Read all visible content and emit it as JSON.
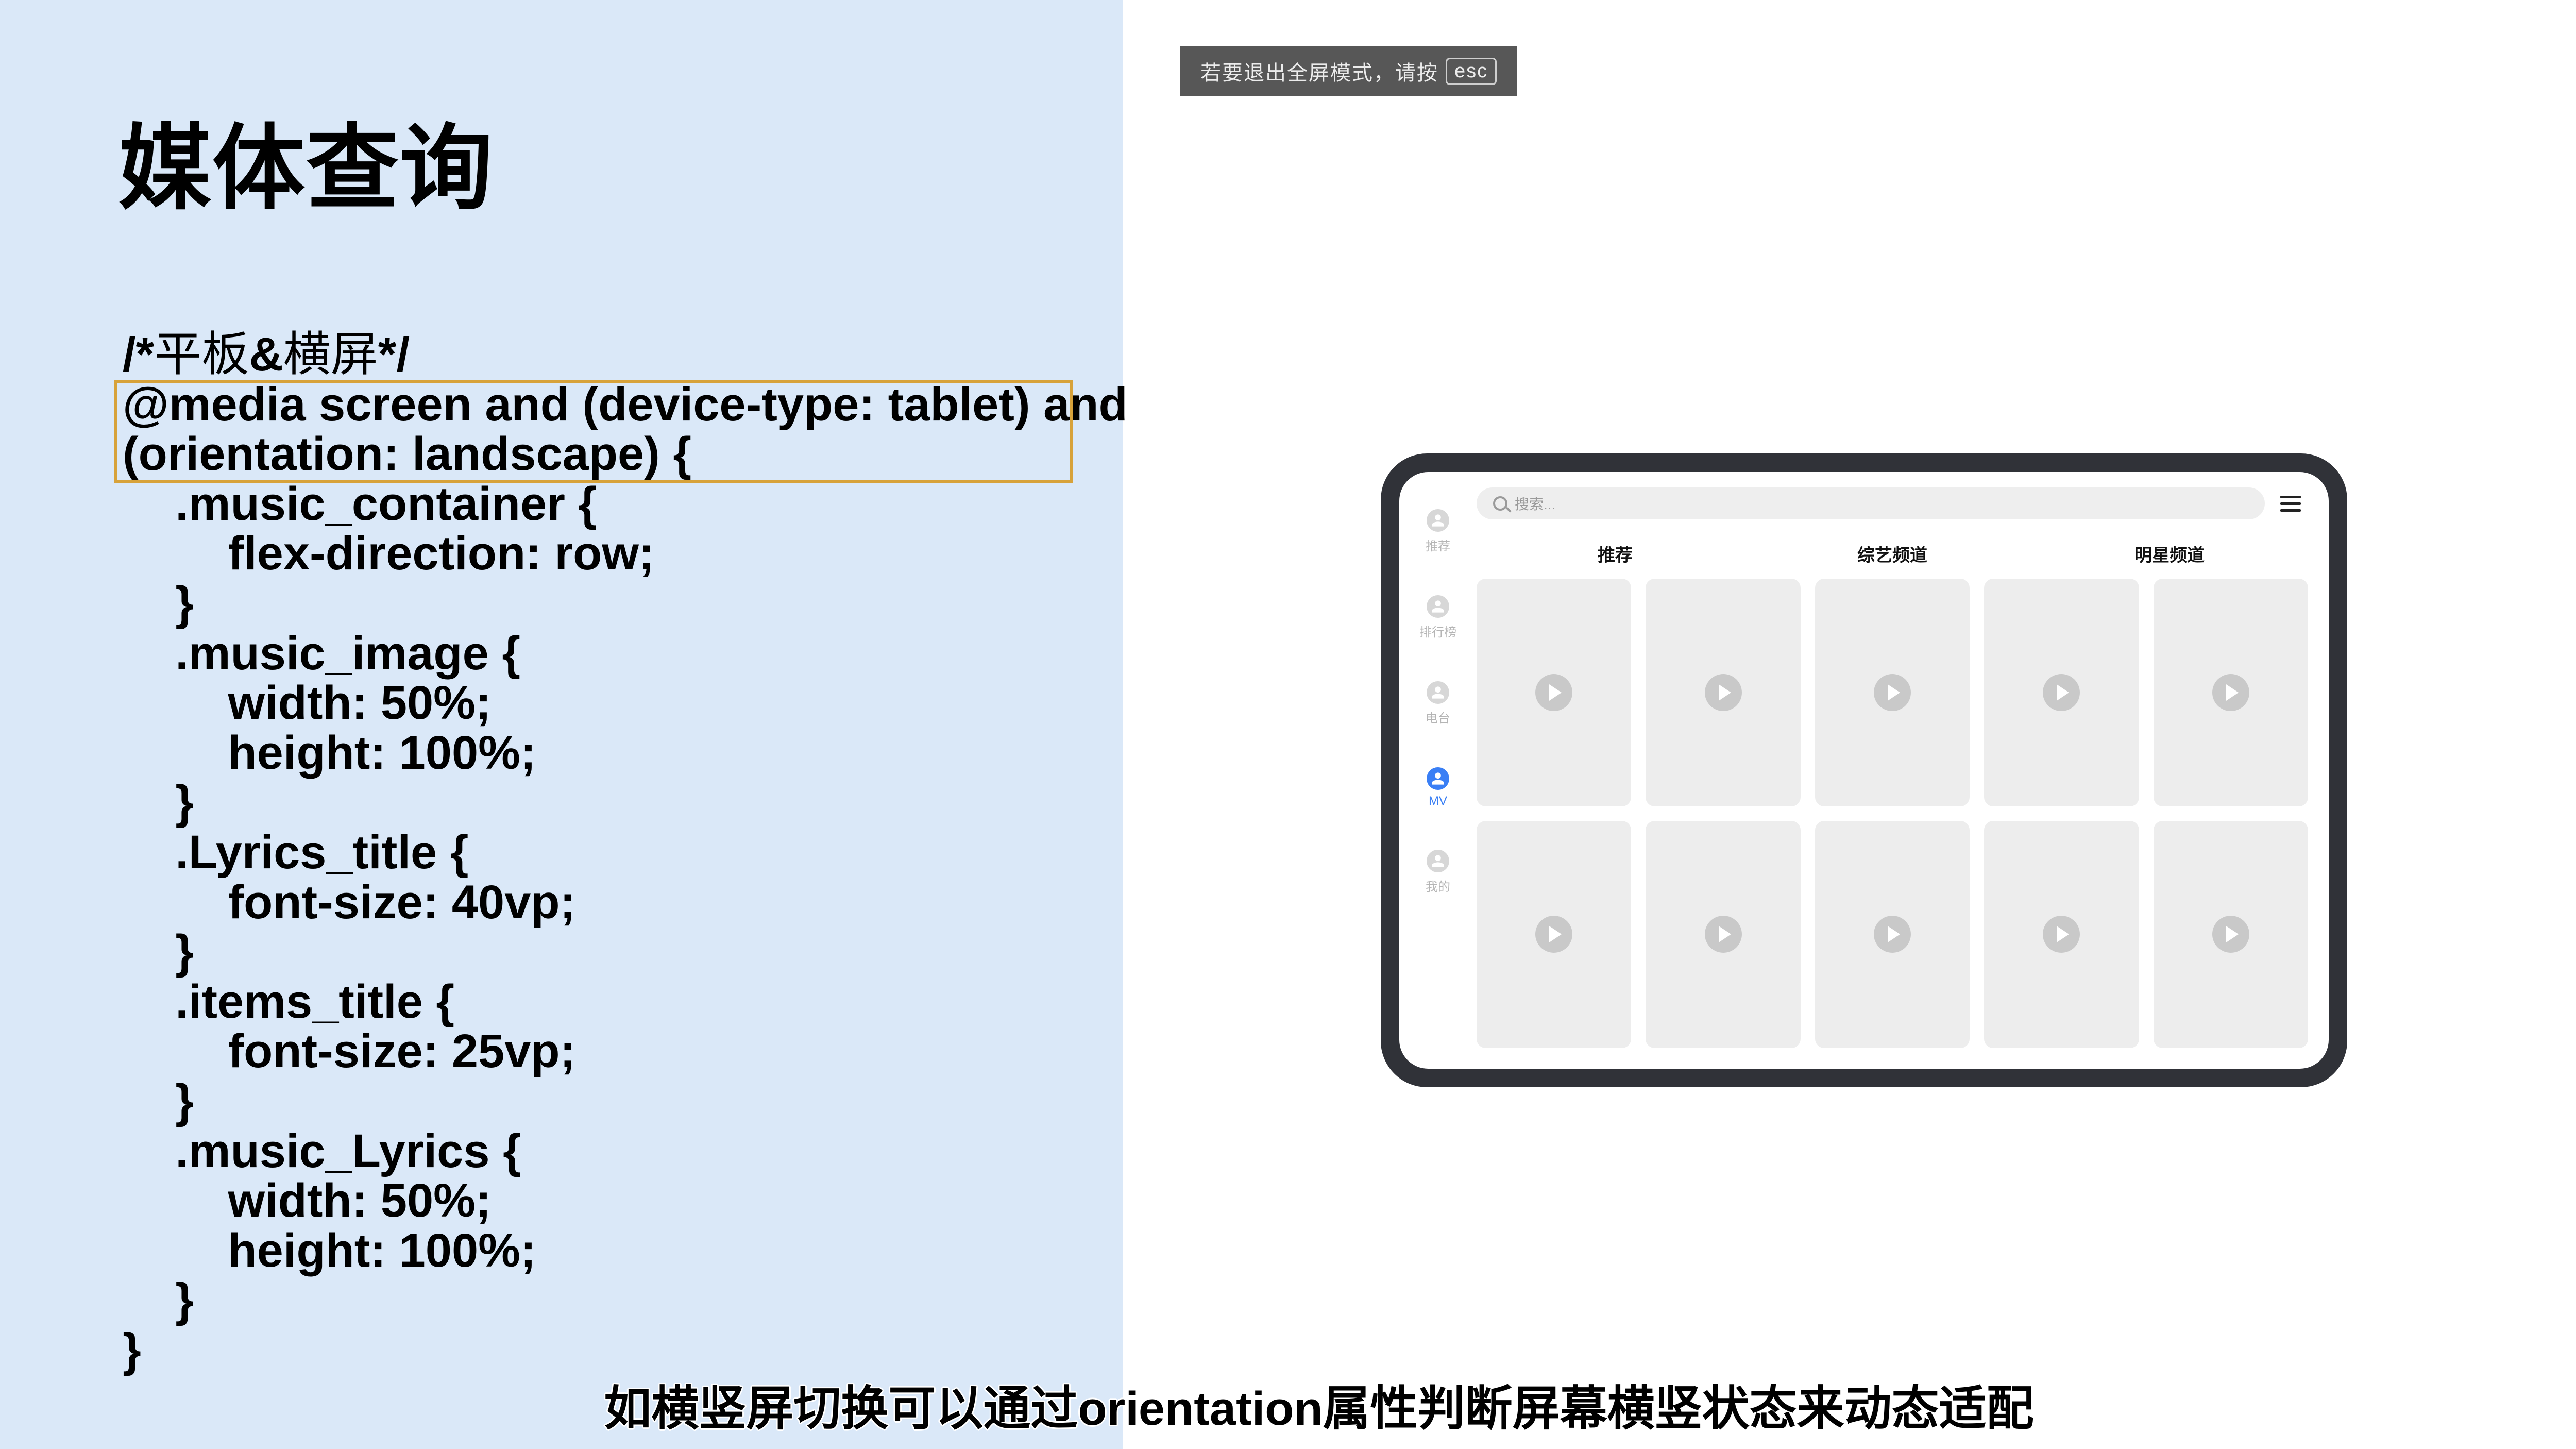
{
  "slide": {
    "title": "媒体查询",
    "code_lines": [
      "/*平板&横屏*/",
      "@media screen and (device-type: tablet) and",
      "(orientation: landscape) {",
      "    .music_container {",
      "        flex-direction: row;",
      "    }",
      "    .music_image {",
      "        width: 50%;",
      "        height: 100%;",
      "    }",
      "    .Lyrics_title {",
      "        font-size: 40vp;",
      "    }",
      "    .items_title {",
      "        font-size: 25vp;",
      "    }",
      "    .music_Lyrics {",
      "        width: 50%;",
      "        height: 100%;",
      "    }",
      "}"
    ]
  },
  "toast": {
    "text": "若要退出全屏模式，请按 ",
    "key": "esc"
  },
  "mock": {
    "search_placeholder": "搜索...",
    "sidebar_items": [
      {
        "label": "推荐",
        "active": false
      },
      {
        "label": "排行榜",
        "active": false
      },
      {
        "label": "电台",
        "active": false
      },
      {
        "label": "MV",
        "active": true
      },
      {
        "label": "我的",
        "active": false
      }
    ],
    "categories": [
      "推荐",
      "综艺频道",
      "明星频道"
    ],
    "card_count": 10
  },
  "caption": "如横竖屏切换可以通过orientation属性判断屏幕横竖状态来动态适配"
}
